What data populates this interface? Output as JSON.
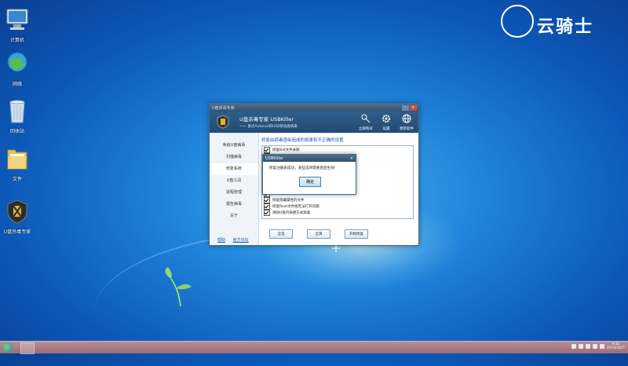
{
  "desktop": {
    "icons": [
      {
        "name": "computer",
        "label": "计算机",
        "icon": "computer-icon"
      },
      {
        "name": "network",
        "label": "网络",
        "icon": "network-icon"
      },
      {
        "name": "recycle",
        "label": "回收站",
        "icon": "recycle-bin-icon"
      },
      {
        "name": "folder",
        "label": "文件",
        "icon": "folder-icon"
      },
      {
        "name": "usbkiller",
        "label": "U盘杀毒专家",
        "icon": "usbkiller-icon"
      }
    ],
    "logo_text": "云骑士"
  },
  "window": {
    "title": "U盘杀毒专家",
    "app_name": "U盘杀毒专家   USBKiller",
    "subtitle": "一一 重点Autorun和USB移动盘病毒",
    "toolbar": [
      {
        "label": "立即购买",
        "icon": "key-icon"
      },
      {
        "label": "设置",
        "icon": "gear-icon"
      },
      {
        "label": "更新软件",
        "icon": "globe-icon"
      }
    ],
    "sidebar": {
      "items": [
        "免疫U盘病毒",
        "扫描病毒",
        "修复系统",
        "U盘工具",
        "进程管理",
        "报告病毒",
        "关于"
      ],
      "active": "修复系统",
      "links": [
        "帮助",
        "官方论坛"
      ]
    },
    "main": {
      "heading": "修复由病毒感染造成的损害和不正确的设置",
      "items": [
        "修复Bat文件关联",
        "",
        "",
        "",
        "",
        "",
        "",
        "",
        "恢复隐藏属性的文件",
        "修复Root文件图无法打开问题",
        "清除U盘内快捷方式病毒"
      ],
      "buttons": [
        "全选",
        "全清",
        "开始修复"
      ]
    }
  },
  "dialog": {
    "title": "USBKiller",
    "message": "修复注册表成功，某些选项需重启后生效!",
    "ok_label": "确定"
  },
  "taskbar": {
    "time": "9:32",
    "date": "2019/10/7"
  }
}
